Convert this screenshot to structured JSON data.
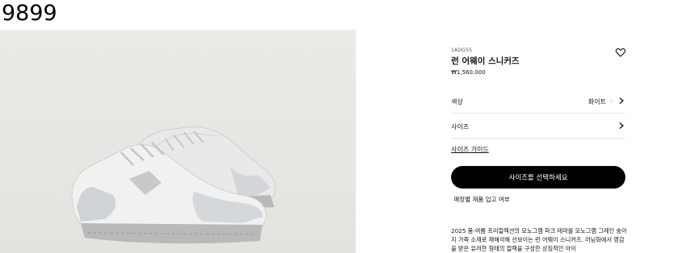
{
  "page_label": "9899",
  "product": {
    "sku": "1ADG5S",
    "name": "런 어웨이 스니커즈",
    "price": "₩1,560,000"
  },
  "options": {
    "color_label": "색상",
    "color_value": "화이트",
    "size_label": "사이즈"
  },
  "size_guide_label": "사이즈 가이드",
  "cta_label": "사이즈를 선택하세요",
  "store_stock_label": "매장별 재품 입고 여부",
  "description": "2025 봄-여름 프리컬렉션의 모노그램 파크 테마를 모노그램 그레인 송아지 가죽 소재로 재해석해 선보이는 런 어웨이 스니커즈. 러닝화에서 영감을 받은 유려한 형태의 컬렉을 구성한 상징적인 아이",
  "icons": [
    "heart-icon",
    "chevron-right-icon",
    "color-dots-icon"
  ],
  "colors": {
    "cta_background": "#000000",
    "image_background": "#e8e7e4",
    "text": "#19110b"
  }
}
